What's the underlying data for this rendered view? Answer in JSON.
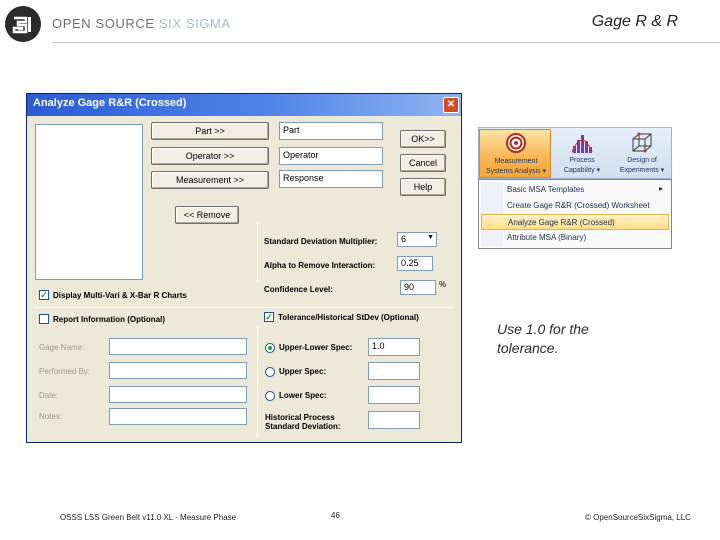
{
  "slide": {
    "brand_text": "OPEN SOURCE ",
    "brand_accent": "SIX SIGMA",
    "title": "Gage R & R",
    "note_line1": "Use 1.0 for the",
    "note_line2": "tolerance.",
    "footer_left": "OSSS LSS Green Belt v11.0 XL - Measure Phase",
    "footer_page": "46",
    "footer_right": "© OpenSourceSixSigma, LLC"
  },
  "dialog": {
    "title": "Analyze Gage R&R (Crossed)",
    "close_glyph": "✕",
    "part_button": "Part >>",
    "operator_button": "Operator >>",
    "measurement_button": "Measurement >>",
    "remove_button": "<< Remove",
    "part_field": "Part",
    "operator_field": "Operator",
    "response_field": "Response",
    "ok_button": "OK>>",
    "cancel_button": "Cancel",
    "help_button": "Help",
    "stddev_multiplier_label": "Standard Deviation Multiplier:",
    "stddev_multiplier_value": "6",
    "alpha_label": "Alpha to Remove Interaction:",
    "alpha_value": "0.25",
    "confidence_label": "Confidence Level:",
    "confidence_value": "90",
    "confidence_unit": "%",
    "multivari_label": "Display Multi-Vari & X-Bar R Charts",
    "report_info_label": "Report Information (Optional)",
    "tolerance_label": "Tolerance/Historical StDev (Optional)",
    "gage_name_label": "Gage Name:",
    "performed_by_label": "Performed By:",
    "date_label": "Date:",
    "notes_label": "Notes:",
    "upper_lower_spec_label": "Upper-Lower Spec:",
    "upper_lower_spec_value": "1.0",
    "upper_spec_label": "Upper Spec:",
    "lower_spec_label": "Lower Spec:",
    "historical_label_1": "Historical Process",
    "historical_label_2": "Standard Deviation:"
  },
  "ribbon": {
    "measurement_label_1": "Measurement",
    "measurement_label_2": "Systems Analysis ▾",
    "process_label_1": "Process",
    "process_label_2": "Capability ▾",
    "doe_label_1": "Design of",
    "doe_label_2": "Experiments ▾",
    "menu": [
      "Basic MSA Templates",
      "Create Gage R&R (Crossed) Worksheet",
      "Analyze Gage R&R (Crossed)",
      "Attribute MSA (Binary)"
    ],
    "submenu_arrow": "▸"
  },
  "colors": {
    "titlebar": "#2b5cd3",
    "check_green": "#21a121",
    "highlight": "#ffdd84"
  }
}
